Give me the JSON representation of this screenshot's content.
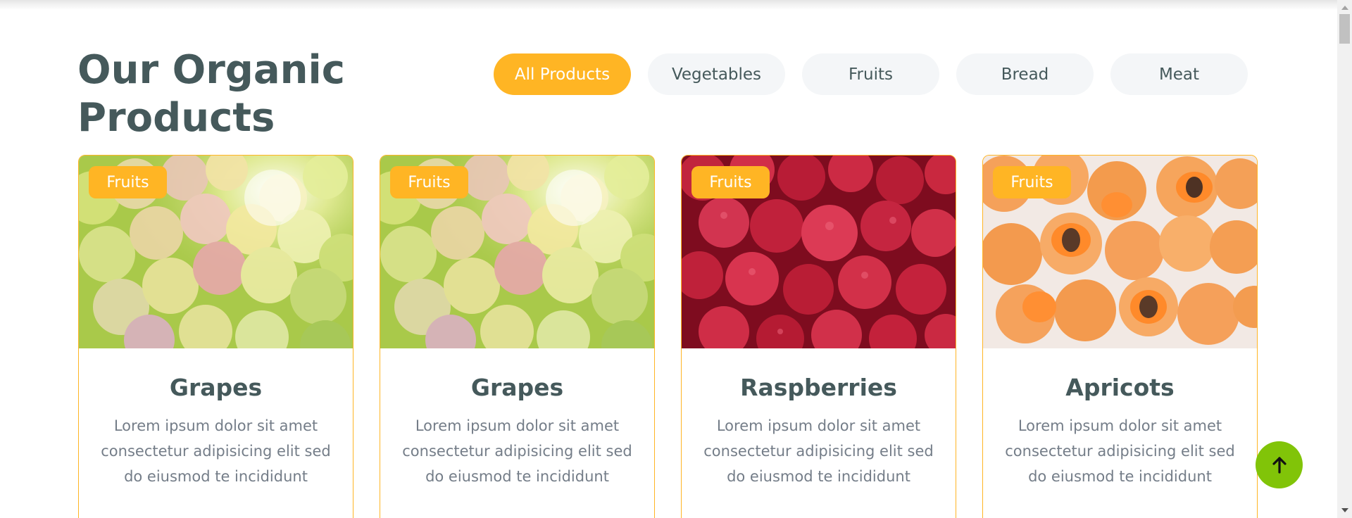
{
  "section": {
    "heading": "Our Organic Products"
  },
  "filters": [
    {
      "label": "All Products",
      "active": true
    },
    {
      "label": "Vegetables",
      "active": false
    },
    {
      "label": "Fruits",
      "active": false
    },
    {
      "label": "Bread",
      "active": false
    },
    {
      "label": "Meat",
      "active": false
    }
  ],
  "products": [
    {
      "badge": "Fruits",
      "title": "Grapes",
      "description": "Lorem ipsum dolor sit amet consectetur adipisicing elit sed do eiusmod te incididunt",
      "image": "grapes-photo"
    },
    {
      "badge": "Fruits",
      "title": "Grapes",
      "description": "Lorem ipsum dolor sit amet consectetur adipisicing elit sed do eiusmod te incididunt",
      "image": "grapes-photo"
    },
    {
      "badge": "Fruits",
      "title": "Raspberries",
      "description": "Lorem ipsum dolor sit amet consectetur adipisicing elit sed do eiusmod te incididunt",
      "image": "raspberries-photo"
    },
    {
      "badge": "Fruits",
      "title": "Apricots",
      "description": "Lorem ipsum dolor sit amet consectetur adipisicing elit sed do eiusmod te incididunt",
      "image": "apricots-photo"
    }
  ],
  "back_to_top": {
    "icon": "arrow-up-icon"
  },
  "colors": {
    "accent": "#ffb524",
    "primary_green": "#81c408",
    "heading": "#45595b",
    "body_text": "#747d88",
    "filter_bg": "#f4f6f8"
  }
}
